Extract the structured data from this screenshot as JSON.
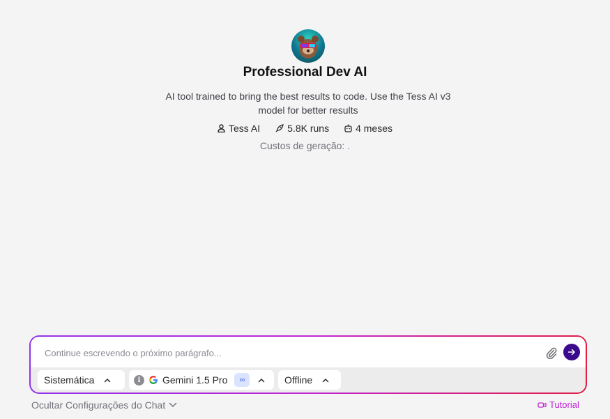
{
  "agent": {
    "title": "Professional Dev AI",
    "description": "AI tool trained to bring the best results to code. Use the Tess AI v3 model for better results",
    "author": "Tess AI",
    "runs": "5.8K runs",
    "age": "4 meses",
    "cost_text": "Custos de geração: ."
  },
  "composer": {
    "placeholder": "Continue escrevendo o próximo parágrafo...",
    "value": "",
    "gradient_colors": [
      "#9333ea",
      "#c026d3",
      "#e11d48"
    ],
    "send_color": "#3b0a8c"
  },
  "controls": {
    "system_label": "Sistemática",
    "model_label": "Gemini 1.5 Pro",
    "model_badge": "∞",
    "status_label": "Offline"
  },
  "footer": {
    "toggle_label": "Ocultar Configurações do Chat",
    "tutorial_label": "Tutorial",
    "tutorial_color": "#c026d3"
  },
  "icons": {
    "author": "user-icon",
    "runs": "rocket-icon",
    "age": "robot-icon",
    "attach": "paperclip-icon",
    "send": "arrow-right-icon",
    "tutorial": "video-icon"
  }
}
